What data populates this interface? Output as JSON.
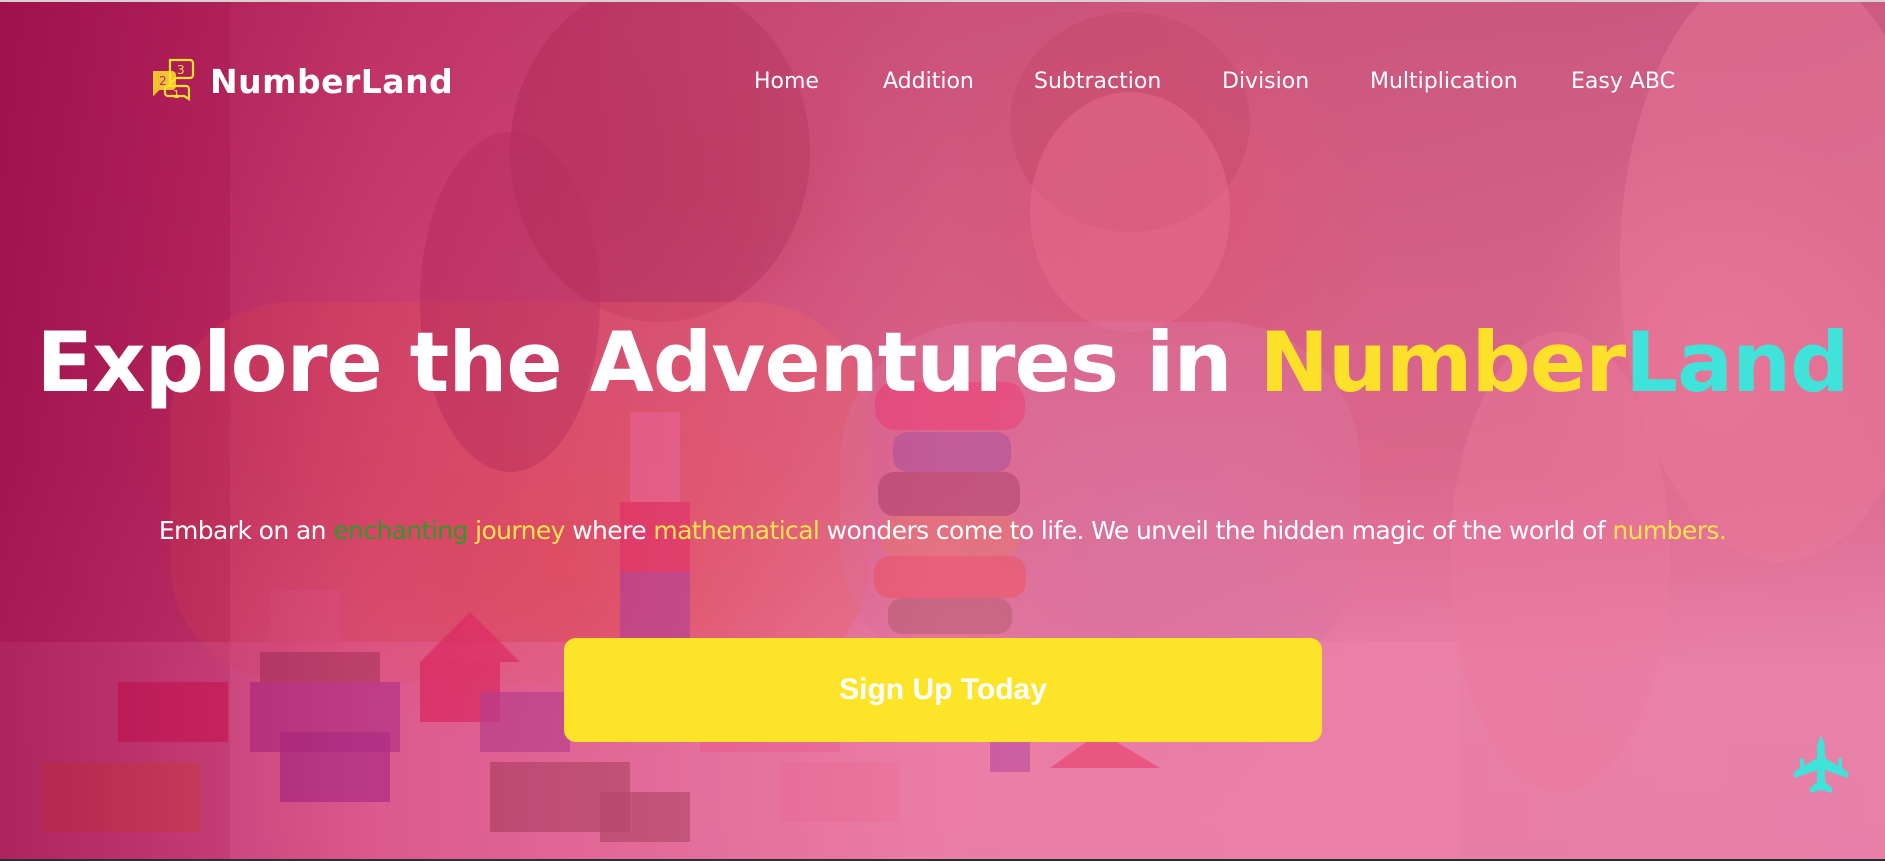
{
  "brand": {
    "name": "NumberLand",
    "icon_digits": [
      "3",
      "2",
      "1"
    ]
  },
  "nav": {
    "items": [
      {
        "label": "Home"
      },
      {
        "label": "Addition"
      },
      {
        "label": "Subtraction"
      },
      {
        "label": "Division"
      },
      {
        "label": "Multiplication"
      },
      {
        "label": "Easy ABC"
      }
    ]
  },
  "hero": {
    "headline_lead": "Explore the Adventures in ",
    "headline_number": "Number",
    "headline_land": "Land",
    "sub_1": "Embark on an ",
    "sub_enchanting": "enchanting",
    "sub_space": " ",
    "sub_journey": "journey",
    "sub_2": " where ",
    "sub_mathematical": "mathematical",
    "sub_3": " wonders come to life. We unveil the hidden magic of the world of ",
    "sub_numbers": "numbers.",
    "cta_label": "Sign Up Today"
  },
  "scroll_top": {
    "icon": "jet-plane-icon"
  },
  "colors": {
    "overlay_pink": "#e2547f",
    "accent_yellow": "#fde02a",
    "accent_cyan": "#3fe3d9",
    "accent_green": "#2f9a26",
    "cta_yellow": "#fde428",
    "text_white": "#ffffff"
  }
}
